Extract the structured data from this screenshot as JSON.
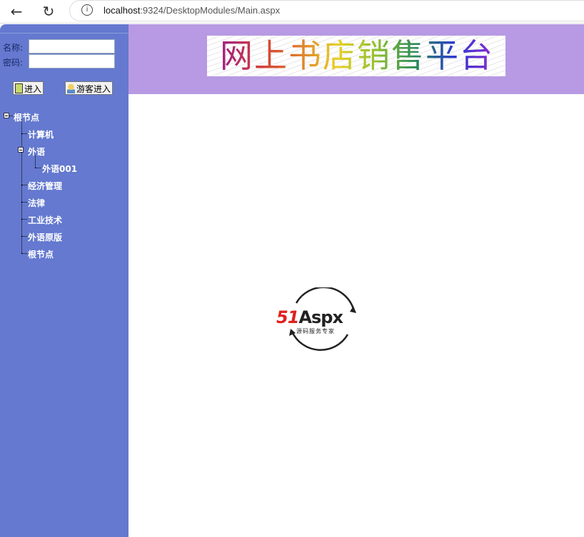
{
  "browser": {
    "url_host": "localhost",
    "url_rest": ":9324/DesktopModules/Main.aspx"
  },
  "login": {
    "name_label": "名称:",
    "password_label": "密码:",
    "name_value": "",
    "password_value": "",
    "login_button": "进入",
    "guest_button": "游客进入"
  },
  "tree": {
    "root": "根节点",
    "items": [
      {
        "label": "计算机"
      },
      {
        "label": "外语",
        "children": [
          "外语001"
        ]
      },
      {
        "label": "经济管理"
      },
      {
        "label": "法律"
      },
      {
        "label": "工业技术"
      },
      {
        "label": "外语原版"
      },
      {
        "label": "根节点"
      }
    ]
  },
  "header": {
    "banner_title": "网上书店销售平台"
  },
  "logo": {
    "brand_num": "51",
    "brand_text": "Aspx",
    "tagline": "源码服务专家"
  }
}
